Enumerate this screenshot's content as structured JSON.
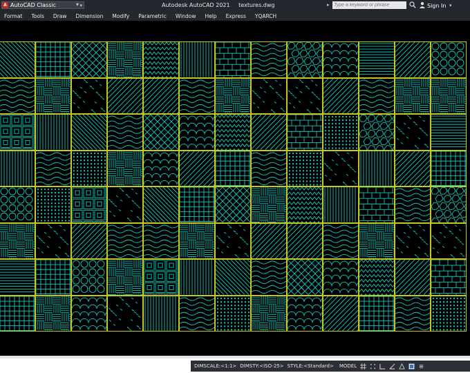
{
  "titlebar": {
    "workspace": "AutoCAD Classic",
    "app_name": "Autodesk AutoCAD 2021",
    "file_name": "textures.dwg",
    "search_placeholder": "Type a keyword or phrase",
    "sign_in": "Sign In"
  },
  "menu": [
    "Format",
    "Tools",
    "Draw",
    "Dimension",
    "Modify",
    "Parametric",
    "Window",
    "Help",
    "Express",
    "YQARCH"
  ],
  "statusbar": {
    "dimscale": "DIMSCALE:<1:1>",
    "dimsty": "DIMSTY:<ISO-25>",
    "style": "STYLE:<Standard>",
    "model": "MODEL"
  },
  "colors": {
    "hatch": "#14c8c0",
    "tile_border": "#c8c820",
    "canvas": "#000000",
    "chrome": "#23272e"
  },
  "icons": [
    "autocad-logo-icon",
    "chevron-down-icon",
    "search-icon",
    "user-icon",
    "grid-icon",
    "snap-icon",
    "ortho-icon",
    "polar-icon",
    "annotation-icon",
    "workspace-icon",
    "customize-icon"
  ]
}
